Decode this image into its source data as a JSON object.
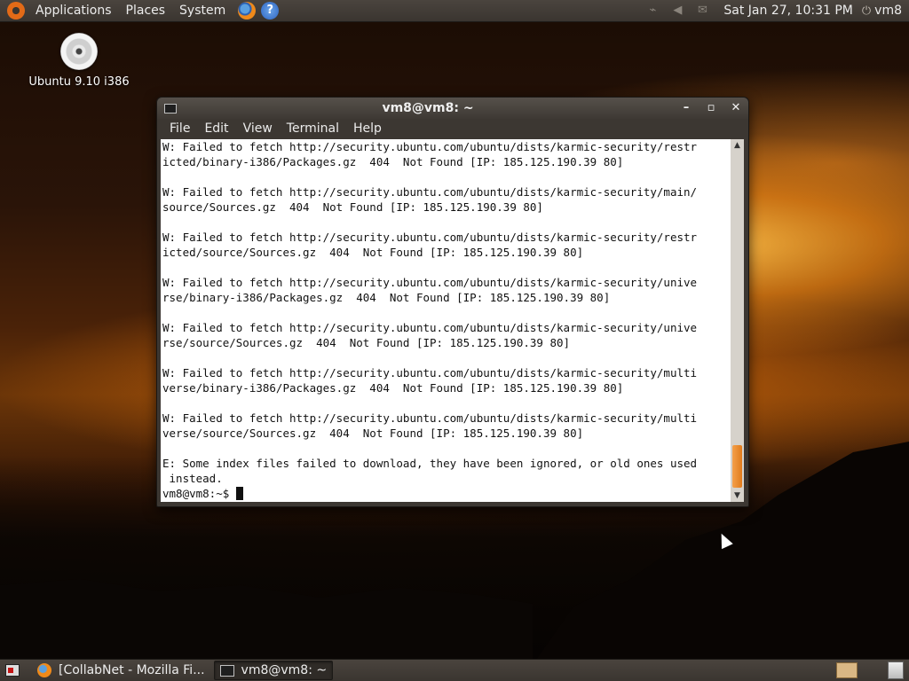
{
  "top_panel": {
    "menus": [
      "Applications",
      "Places",
      "System"
    ],
    "clock": "Sat Jan 27, 10:31 PM",
    "user": "vm8",
    "help_glyph": "?"
  },
  "desktop": {
    "icon_label": "Ubuntu 9.10 i386"
  },
  "window": {
    "title": "vm8@vm8: ~",
    "menus": [
      "File",
      "Edit",
      "View",
      "Terminal",
      "Help"
    ],
    "buttons": {
      "minimize": "–",
      "maximize": "▫",
      "close": "✕"
    },
    "terminal_lines": [
      "W: Failed to fetch http://security.ubuntu.com/ubuntu/dists/karmic-security/restr",
      "icted/binary-i386/Packages.gz  404  Not Found [IP: 185.125.190.39 80]",
      "",
      "W: Failed to fetch http://security.ubuntu.com/ubuntu/dists/karmic-security/main/",
      "source/Sources.gz  404  Not Found [IP: 185.125.190.39 80]",
      "",
      "W: Failed to fetch http://security.ubuntu.com/ubuntu/dists/karmic-security/restr",
      "icted/source/Sources.gz  404  Not Found [IP: 185.125.190.39 80]",
      "",
      "W: Failed to fetch http://security.ubuntu.com/ubuntu/dists/karmic-security/unive",
      "rse/binary-i386/Packages.gz  404  Not Found [IP: 185.125.190.39 80]",
      "",
      "W: Failed to fetch http://security.ubuntu.com/ubuntu/dists/karmic-security/unive",
      "rse/source/Sources.gz  404  Not Found [IP: 185.125.190.39 80]",
      "",
      "W: Failed to fetch http://security.ubuntu.com/ubuntu/dists/karmic-security/multi",
      "verse/binary-i386/Packages.gz  404  Not Found [IP: 185.125.190.39 80]",
      "",
      "W: Failed to fetch http://security.ubuntu.com/ubuntu/dists/karmic-security/multi",
      "verse/source/Sources.gz  404  Not Found [IP: 185.125.190.39 80]",
      "",
      "E: Some index files failed to download, they have been ignored, or old ones used",
      " instead."
    ],
    "prompt": "vm8@vm8:~$ "
  },
  "taskbar": {
    "tasks": [
      "[CollabNet - Mozilla Fi...",
      "vm8@vm8: ~"
    ]
  }
}
